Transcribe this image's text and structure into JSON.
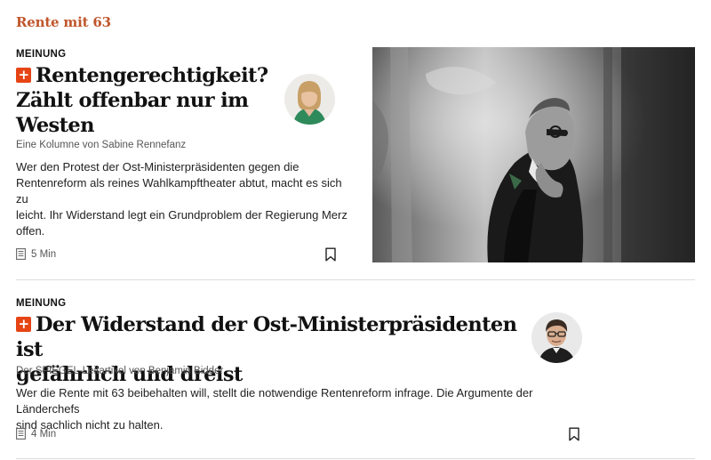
{
  "section": {
    "title": "Rente mit 63"
  },
  "articles": [
    {
      "kicker": "MEINUNG",
      "headline_lines": [
        "Rentengerechtigkeit?",
        "Zählt offenbar nur im",
        "Westen"
      ],
      "byline": "Eine Kolumne von Sabine Rennefanz",
      "teaser_lines": [
        "Wer den Protest der Ost-Ministerpräsidenten gegen die",
        "Rentenreform als reines Wahlkampftheater abtut, macht es sich zu",
        "leicht. Ihr Widerstand legt ein Grundproblem der Regierung Merz",
        "offen."
      ],
      "read_time": "5 Min"
    },
    {
      "kicker": "MEINUNG",
      "headline_lines": [
        "Der Widerstand der Ost-Ministerpräsidenten ist",
        "gefährlich und dreist"
      ],
      "byline": "Der SPIEGEL-Leitartikel von Benjamin Bidder",
      "teaser_lines": [
        "Wer die Rente mit 63 beibehalten will, stellt die notwendige Rentenreform infrage. Die Argumente der Länderchefs",
        "sind sachlich nicht zu halten."
      ],
      "read_time": "4 Min"
    }
  ],
  "colors": {
    "accent": "#c0562b",
    "plus_badge": "#e64415"
  },
  "icons": {
    "plus": "plus-badge-icon",
    "read_time": "article-icon",
    "bookmark": "bookmark-icon"
  }
}
